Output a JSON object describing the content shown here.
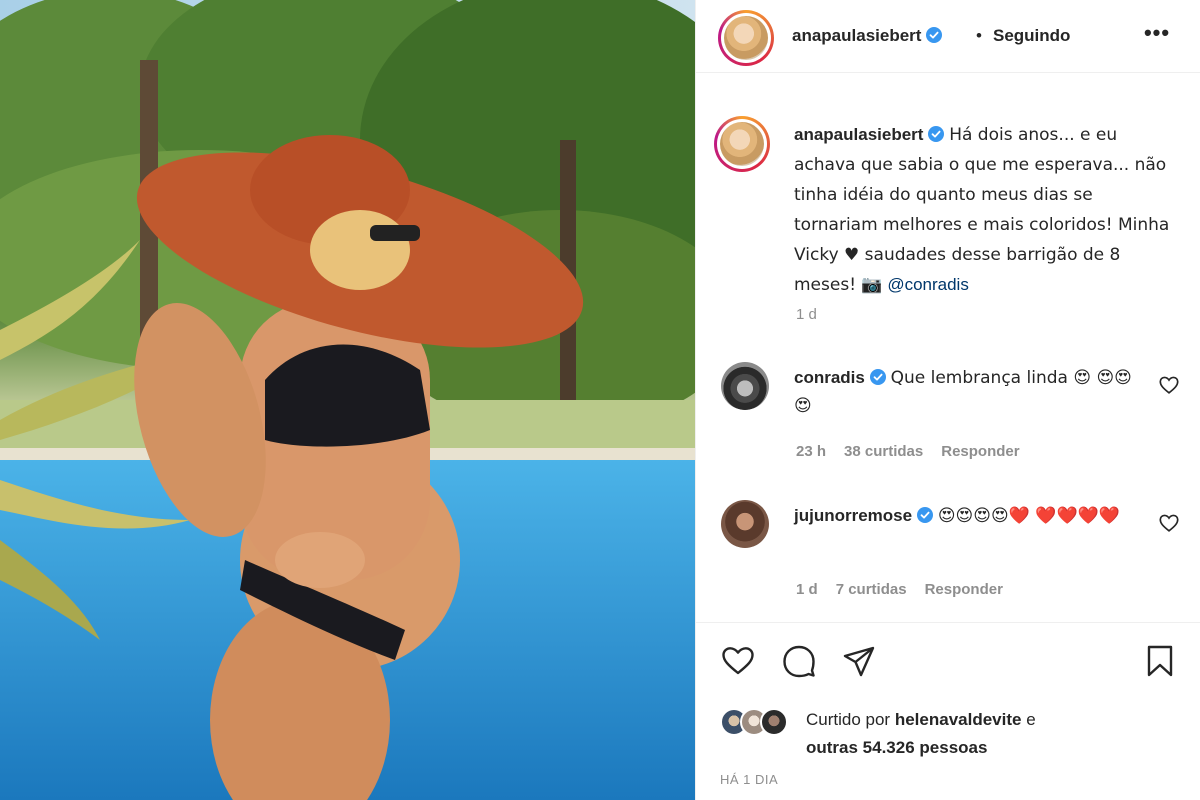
{
  "header": {
    "username": "anapaulasiebert",
    "separator": "•",
    "follow_status": "Seguindo",
    "more_label": "•••"
  },
  "caption": {
    "username": "anapaulasiebert",
    "text": "Há dois anos... e eu achava que sabia o que me esperava... não tinha idéia do quanto meus dias se tornariam melhores e mais coloridos! Minha Vicky ♥ saudades desse barrigão de 8 meses! 📷",
    "mention": "@conradis",
    "time": "1 d"
  },
  "comments": [
    {
      "username": "conradis",
      "text": "Que lembrança linda 😍 😍😍😍",
      "time": "23 h",
      "likes": "38 curtidas",
      "reply": "Responder"
    },
    {
      "username": "jujunorremose",
      "text": "😍😍😍😍❤️ ❤️❤️❤️❤️",
      "time": "1 d",
      "likes": "7 curtidas",
      "reply": "Responder"
    }
  ],
  "likes": {
    "prefix": "Curtido por",
    "user": "helenavaldevite",
    "connector": "e",
    "others": "outras 54.326 pessoas"
  },
  "post_time": "HÁ 1 DIA",
  "colors": {
    "verified": "#3897f0",
    "link": "#00376b",
    "muted": "#8e8e8e"
  }
}
